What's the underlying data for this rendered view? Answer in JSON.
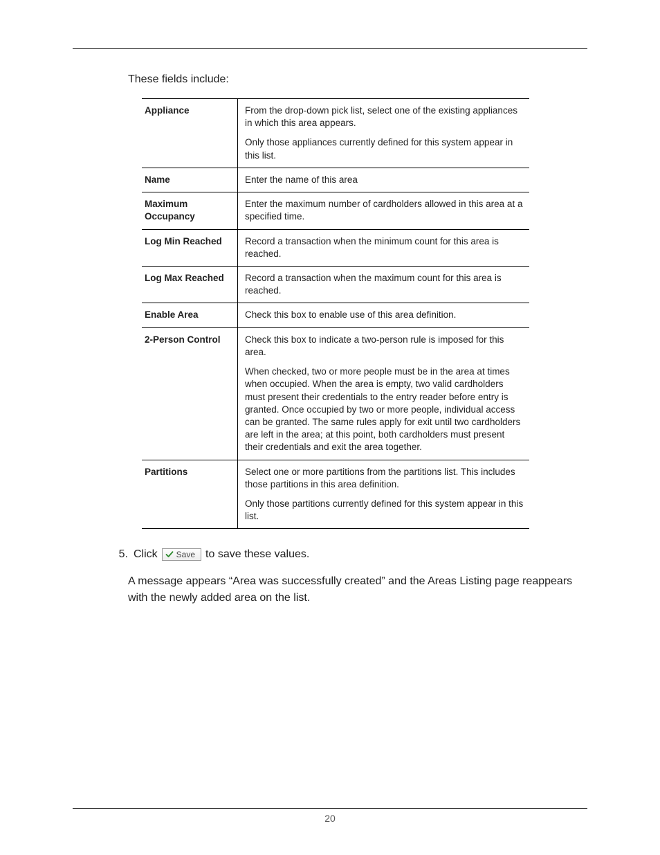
{
  "intro": "These fields include:",
  "rows": [
    {
      "label": "Appliance",
      "paras": [
        "From the drop-down pick list, select one of the existing appliances in which this area appears.",
        "Only those appliances currently defined for this system appear in this list."
      ]
    },
    {
      "label": "Name",
      "paras": [
        "Enter the name of this area"
      ]
    },
    {
      "label": "Maximum Occupancy",
      "paras": [
        "Enter the maximum number of cardholders allowed in this area at a specified time."
      ]
    },
    {
      "label": "Log Min Reached",
      "paras": [
        "Record a transaction when the minimum count for this area is reached."
      ]
    },
    {
      "label": "Log Max Reached",
      "paras": [
        "Record a transaction when the maximum count for this area is reached."
      ]
    },
    {
      "label": "Enable Area",
      "paras": [
        "Check this box to enable use of this area definition."
      ]
    },
    {
      "label": "2-Person Control",
      "paras": [
        "Check this box to indicate a two-person rule is imposed for this area.",
        "When checked, two or more people must be in the area at times when occupied. When the area is empty, two valid cardholders must present their credentials to the entry reader before entry is granted. Once occupied by two or more people, individual access can be granted. The same rules apply for exit until two cardholders are left in the area; at this point, both cardholders must present their credentials and exit the area together."
      ]
    },
    {
      "label": "Partitions",
      "paras": [
        "Select one or more partitions from the partitions list. This includes those partitions in this area definition.",
        "Only those partitions currently defined for this system appear in this list."
      ]
    }
  ],
  "step": {
    "number": "5.",
    "click_word": "Click",
    "save_label": "Save",
    "after": "to save these values."
  },
  "result_text": "A message appears “Area was successfully created” and the Areas Listing page reappears with the newly added area on the list.",
  "page_number": "20"
}
